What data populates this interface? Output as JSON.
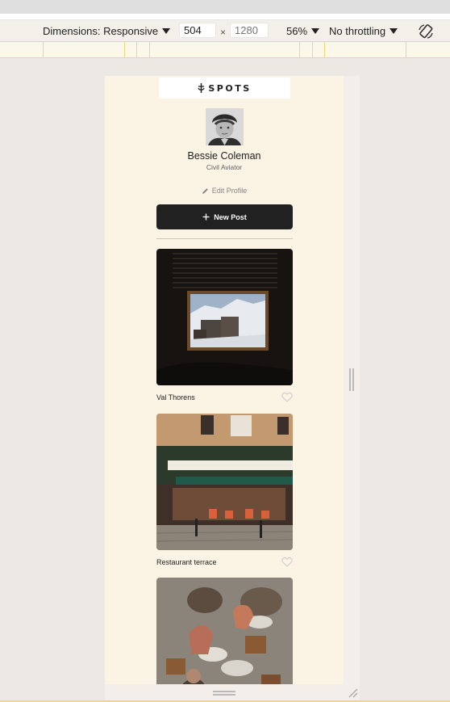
{
  "devtools": {
    "dimensions_label": "Dimensions: Responsive",
    "width_value": "504",
    "height_placeholder": "1280",
    "times_sign": "×",
    "zoom": "56%",
    "throttling": "No throttling",
    "icons": [
      "rotate-icon",
      "dropdown-arrow-icon",
      "resize-handle-icon"
    ]
  },
  "app": {
    "logo_text": "SPOTS",
    "profile": {
      "name": "Bessie Coleman",
      "title": "Civil Aviator"
    },
    "edit_profile_label": "Edit Profile",
    "new_post_label": "New Post",
    "cards": [
      {
        "title": "Val Thorens"
      },
      {
        "title": "Restaurant terrace"
      },
      {
        "title": ""
      }
    ]
  },
  "colors": {
    "page_bg": "#fbf3e4",
    "button_dark": "#212121",
    "devtools_ruler": "#f0d77a"
  }
}
